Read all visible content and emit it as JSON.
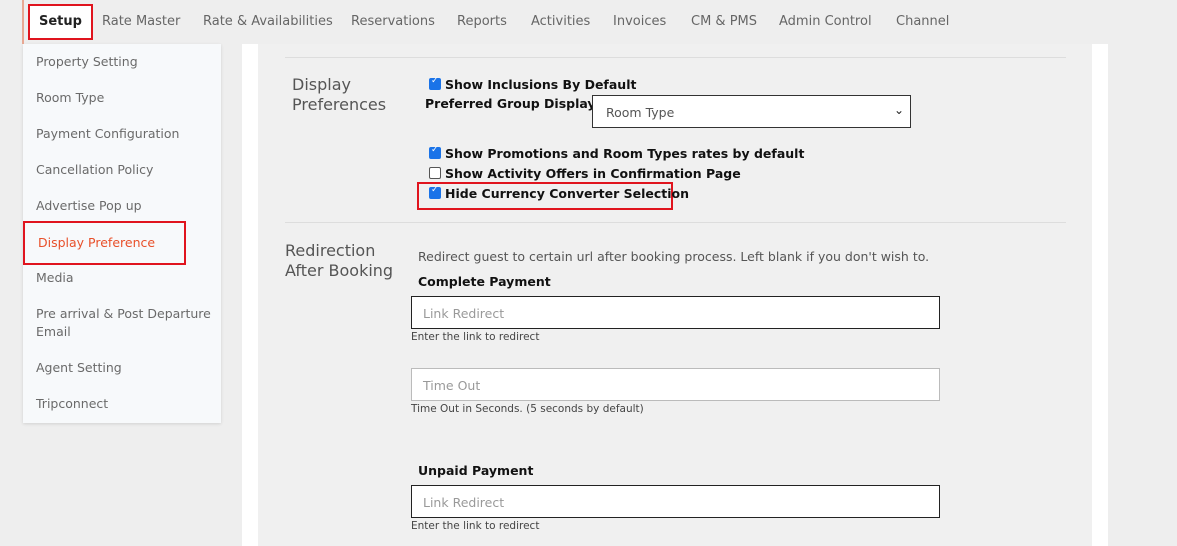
{
  "topnav": {
    "tabs": [
      {
        "label": "Setup"
      },
      {
        "label": "Rate Master"
      },
      {
        "label": "Rate & Availabilities"
      },
      {
        "label": "Reservations"
      },
      {
        "label": "Reports"
      },
      {
        "label": "Activities"
      },
      {
        "label": "Invoices"
      },
      {
        "label": "CM & PMS"
      },
      {
        "label": "Admin Control"
      },
      {
        "label": "Channel"
      }
    ],
    "active": "Setup"
  },
  "sidebar": {
    "items": [
      {
        "label": "Property Setting"
      },
      {
        "label": "Room Type"
      },
      {
        "label": "Payment Configuration"
      },
      {
        "label": "Cancellation Policy"
      },
      {
        "label": "Advertise Pop up"
      },
      {
        "label": "Display Preference"
      },
      {
        "label": "Media"
      },
      {
        "label": "Pre arrival & Post Departure Email"
      },
      {
        "label": "Agent Setting"
      },
      {
        "label": "Tripconnect"
      }
    ],
    "active": "Display Preference"
  },
  "display_preferences": {
    "title": "Display Preferences",
    "show_inclusions": {
      "label": "Show Inclusions By Default",
      "checked": true
    },
    "preferred_group_label": "Preferred Group Display",
    "preferred_group_value": "Room Type",
    "show_promotions": {
      "label": "Show Promotions and Room Types rates by default",
      "checked": true
    },
    "show_activity_offers": {
      "label": "Show Activity Offers in Confirmation Page",
      "checked": false
    },
    "hide_currency_converter": {
      "label": "Hide Currency Converter Selection",
      "checked": true
    }
  },
  "redirection": {
    "title": "Redirection After Booking",
    "description": "Redirect guest to certain url after booking process. Left blank if you don't wish to.",
    "complete_payment": {
      "label": "Complete Payment",
      "link_placeholder": "Link Redirect",
      "link_help": "Enter the link to redirect",
      "timeout_placeholder": "Time Out",
      "timeout_help": "Time Out in Seconds. (5 seconds by default)"
    },
    "unpaid_payment": {
      "label": "Unpaid Payment",
      "link_placeholder": "Link Redirect",
      "link_help": "Enter the link to redirect"
    }
  },
  "colors": {
    "accent": "#e8502a",
    "highlight": "#e0141e",
    "checkbox": "#1a73e8"
  }
}
